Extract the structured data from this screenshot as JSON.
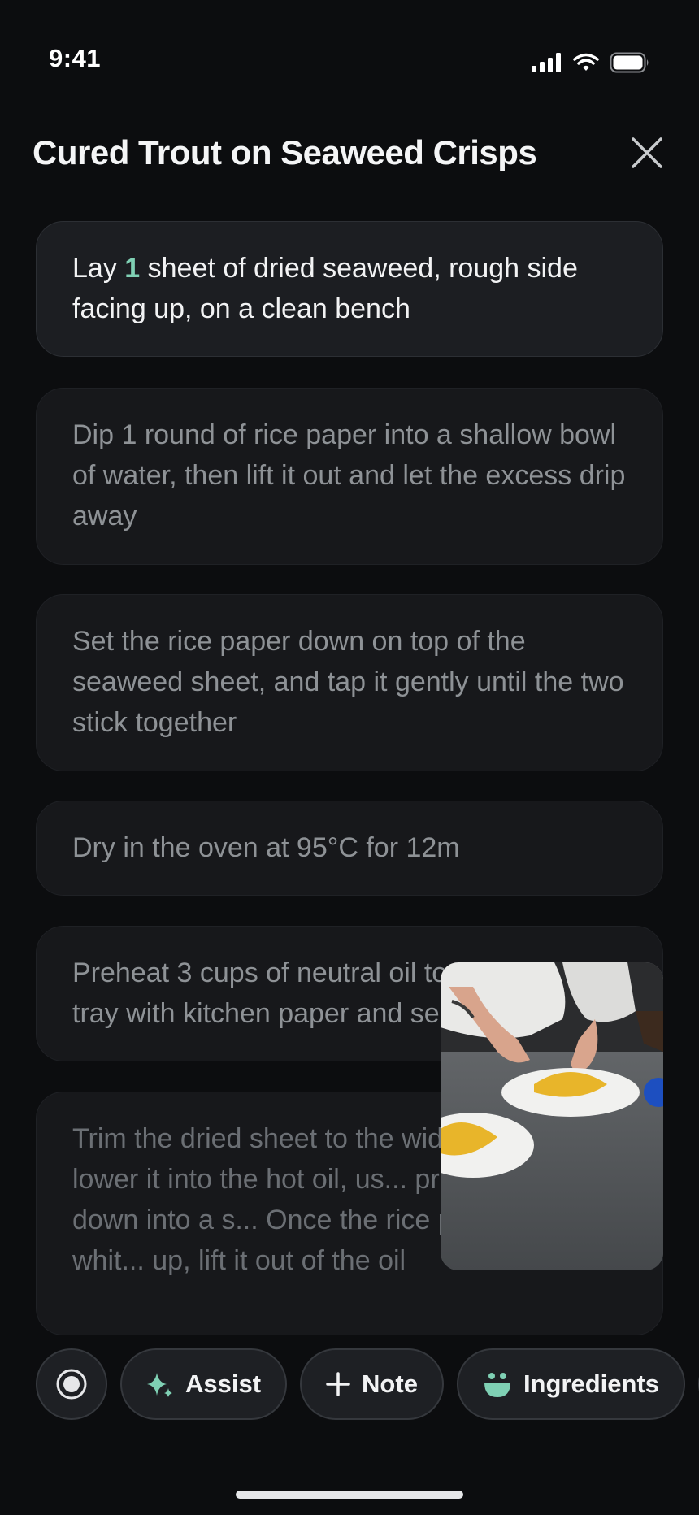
{
  "status_bar": {
    "time": "9:41"
  },
  "header": {
    "title": "Cured Trout on Seaweed Crisps"
  },
  "steps": [
    {
      "prefix": "Lay ",
      "number": "1",
      "suffix": " sheet of dried seaweed, rough side facing up, on a clean bench"
    },
    {
      "text": "Dip 1 round of rice paper into a shallow bowl of water, then lift it out and let the excess drip away"
    },
    {
      "text": "Set the rice paper down on top of the seaweed sheet, and tap it gently until the two stick together"
    },
    {
      "text": "Dry in the oven at 95°C for 12m"
    },
    {
      "text": "Preheat 3 cups of neutral oil to 1?0°C. Line a tray with kitchen paper and se..."
    },
    {
      "text": "Trim the dried sheet to the width of ... and lower it into the hot oil, us... press the centre down into a s... Once the rice paper turns whit... up, lift it out of the oil"
    }
  ],
  "toolbar": {
    "assist_label": "Assist",
    "note_label": "Note",
    "ingredients_label": "Ingredients"
  },
  "colors": {
    "accent": "#7fd0b4",
    "background": "#0c0d0f",
    "card": "#17181b"
  }
}
